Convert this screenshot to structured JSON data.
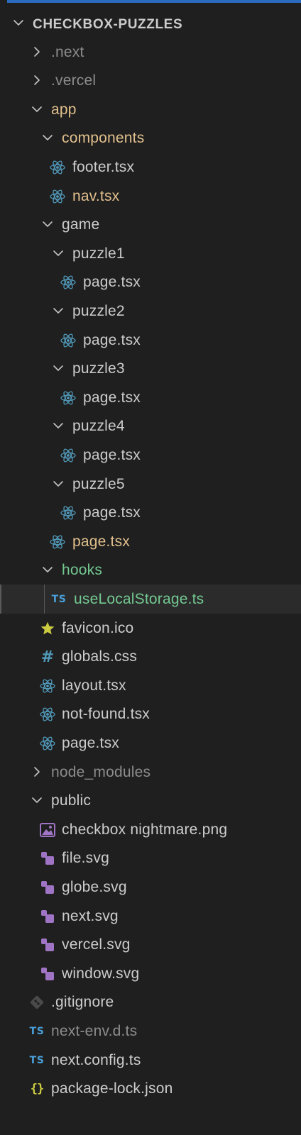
{
  "explorer": {
    "root": {
      "label": "CHECKBOX-PUZZLES",
      "expanded": true
    },
    "items": [
      {
        "label": ".next",
        "type": "folder",
        "depth": 1,
        "expanded": false,
        "color": "dim"
      },
      {
        "label": ".vercel",
        "type": "folder",
        "depth": 1,
        "expanded": false,
        "color": "dim"
      },
      {
        "label": "app",
        "type": "folder",
        "depth": 1,
        "expanded": true,
        "color": "mod"
      },
      {
        "label": "components",
        "type": "folder",
        "depth": 2,
        "expanded": true,
        "color": "mod"
      },
      {
        "label": "footer.tsx",
        "type": "file",
        "icon": "react-icon",
        "depth": 3,
        "color": "norm"
      },
      {
        "label": "nav.tsx",
        "type": "file",
        "icon": "react-icon",
        "depth": 3,
        "color": "mod"
      },
      {
        "label": "game",
        "type": "folder",
        "depth": 2,
        "expanded": true,
        "color": "norm"
      },
      {
        "label": "puzzle1",
        "type": "folder",
        "depth": 3,
        "expanded": true,
        "color": "norm"
      },
      {
        "label": "page.tsx",
        "type": "file",
        "icon": "react-icon",
        "depth": 4,
        "color": "norm"
      },
      {
        "label": "puzzle2",
        "type": "folder",
        "depth": 3,
        "expanded": true,
        "color": "norm"
      },
      {
        "label": "page.tsx",
        "type": "file",
        "icon": "react-icon",
        "depth": 4,
        "color": "norm"
      },
      {
        "label": "puzzle3",
        "type": "folder",
        "depth": 3,
        "expanded": true,
        "color": "norm"
      },
      {
        "label": "page.tsx",
        "type": "file",
        "icon": "react-icon",
        "depth": 4,
        "color": "norm"
      },
      {
        "label": "puzzle4",
        "type": "folder",
        "depth": 3,
        "expanded": true,
        "color": "norm"
      },
      {
        "label": "page.tsx",
        "type": "file",
        "icon": "react-icon",
        "depth": 4,
        "color": "norm"
      },
      {
        "label": "puzzle5",
        "type": "folder",
        "depth": 3,
        "expanded": true,
        "color": "norm"
      },
      {
        "label": "page.tsx",
        "type": "file",
        "icon": "react-icon",
        "depth": 4,
        "color": "norm"
      },
      {
        "label": "page.tsx",
        "type": "file",
        "icon": "react-icon",
        "depth": 3,
        "color": "mod"
      },
      {
        "label": "hooks",
        "type": "folder",
        "depth": 2,
        "expanded": true,
        "color": "new"
      },
      {
        "label": "useLocalStorage.ts",
        "type": "file",
        "icon": "typescript-icon",
        "depth": 3,
        "color": "new",
        "selected": true
      },
      {
        "label": "favicon.ico",
        "type": "file",
        "icon": "star-icon",
        "depth": 2,
        "color": "norm"
      },
      {
        "label": "globals.css",
        "type": "file",
        "icon": "hash-icon",
        "depth": 2,
        "color": "norm"
      },
      {
        "label": "layout.tsx",
        "type": "file",
        "icon": "react-icon",
        "depth": 2,
        "color": "norm"
      },
      {
        "label": "not-found.tsx",
        "type": "file",
        "icon": "react-icon",
        "depth": 2,
        "color": "norm"
      },
      {
        "label": "page.tsx",
        "type": "file",
        "icon": "react-icon",
        "depth": 2,
        "color": "norm"
      },
      {
        "label": "node_modules",
        "type": "folder",
        "depth": 1,
        "expanded": false,
        "color": "dim"
      },
      {
        "label": "public",
        "type": "folder",
        "depth": 1,
        "expanded": true,
        "color": "norm"
      },
      {
        "label": "checkbox nightmare.png",
        "type": "file",
        "icon": "image-icon",
        "depth": 2,
        "color": "norm"
      },
      {
        "label": "file.svg",
        "type": "file",
        "icon": "svg-icon",
        "depth": 2,
        "color": "norm"
      },
      {
        "label": "globe.svg",
        "type": "file",
        "icon": "svg-icon",
        "depth": 2,
        "color": "norm"
      },
      {
        "label": "next.svg",
        "type": "file",
        "icon": "svg-icon",
        "depth": 2,
        "color": "norm"
      },
      {
        "label": "vercel.svg",
        "type": "file",
        "icon": "svg-icon",
        "depth": 2,
        "color": "norm"
      },
      {
        "label": "window.svg",
        "type": "file",
        "icon": "svg-icon",
        "depth": 2,
        "color": "norm"
      },
      {
        "label": ".gitignore",
        "type": "file",
        "icon": "git-icon",
        "depth": 1,
        "color": "norm"
      },
      {
        "label": "next-env.d.ts",
        "type": "file",
        "icon": "typescript-icon",
        "depth": 1,
        "color": "dim"
      },
      {
        "label": "next.config.ts",
        "type": "file",
        "icon": "typescript-icon",
        "depth": 1,
        "color": "norm"
      },
      {
        "label": "package-lock.json",
        "type": "file",
        "icon": "json-icon",
        "depth": 1,
        "color": "norm"
      }
    ],
    "icon_text": {
      "ts": "TS",
      "hash": "#",
      "braces": "{}"
    },
    "colors": {
      "accent": "#2a6bbd",
      "react": "#519aba",
      "typescript": "#4a9fd9",
      "star": "#cbcb41",
      "svg": "#a074c4",
      "modified": "#e2c08d",
      "untracked": "#73c991",
      "ignored": "#8c8c8c"
    }
  }
}
